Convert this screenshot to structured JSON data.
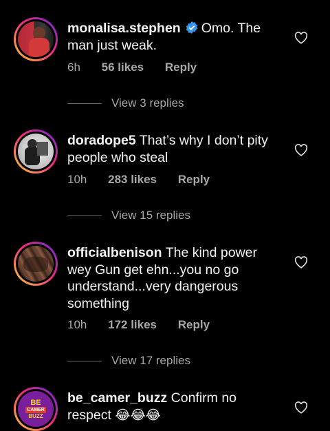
{
  "comments": [
    {
      "username": "monalisa.stephen",
      "verified": true,
      "text": "Omo. The man just weak.",
      "time": "6h",
      "likes": "56 likes",
      "reply": "Reply",
      "view_replies": "View 3 replies"
    },
    {
      "username": "doradope5",
      "verified": false,
      "text": "That’s why I don’t pity people who steal",
      "time": "10h",
      "likes": "283 likes",
      "reply": "Reply",
      "view_replies": "View 15 replies"
    },
    {
      "username": "officialbenison",
      "verified": false,
      "text": "The kind power wey Gun get ehn...you no go understand...very dangerous something",
      "time": "10h",
      "likes": "172 likes",
      "reply": "Reply",
      "view_replies": "View 17 replies"
    },
    {
      "username": "be_camer_buzz",
      "verified": false,
      "text": "Confirm no respect",
      "emoji": "😂😂😂",
      "avatar_text": [
        "BE",
        "CAMER",
        "BUZZ"
      ]
    }
  ],
  "colors": {
    "verified": "#3897f0",
    "secondary_text": "#a8a8a8",
    "background": "#000000"
  },
  "icons": {
    "like": "heart-outline-icon",
    "verified": "verified-badge-icon"
  }
}
